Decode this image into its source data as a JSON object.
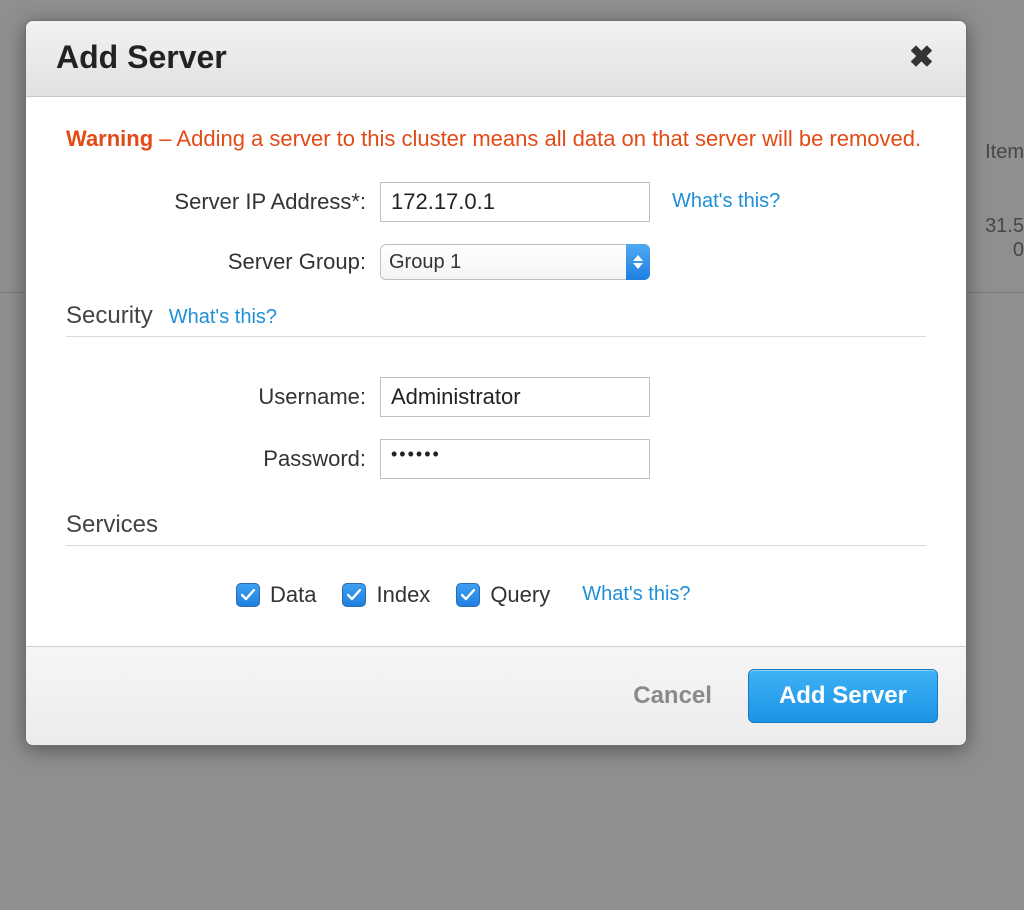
{
  "background": {
    "side_label": "Item",
    "side_value1": "31.5",
    "side_value2": "0"
  },
  "modal": {
    "title": "Add Server",
    "warning_strong": "Warning",
    "warning_rest": " – Adding a server to this cluster means all data on that server will be removed.",
    "ip_label": "Server IP Address*:",
    "ip_value": "172.17.0.1",
    "ip_help": "What's this?",
    "group_label": "Server Group:",
    "group_value": "Group 1",
    "security_title": "Security",
    "security_help": "What's this?",
    "username_label": "Username:",
    "username_value": "Administrator",
    "password_label": "Password:",
    "password_display": "••••••",
    "services_title": "Services",
    "services": {
      "data_label": "Data",
      "index_label": "Index",
      "query_label": "Query",
      "help": "What's this?"
    },
    "footer": {
      "cancel": "Cancel",
      "submit": "Add Server"
    }
  }
}
